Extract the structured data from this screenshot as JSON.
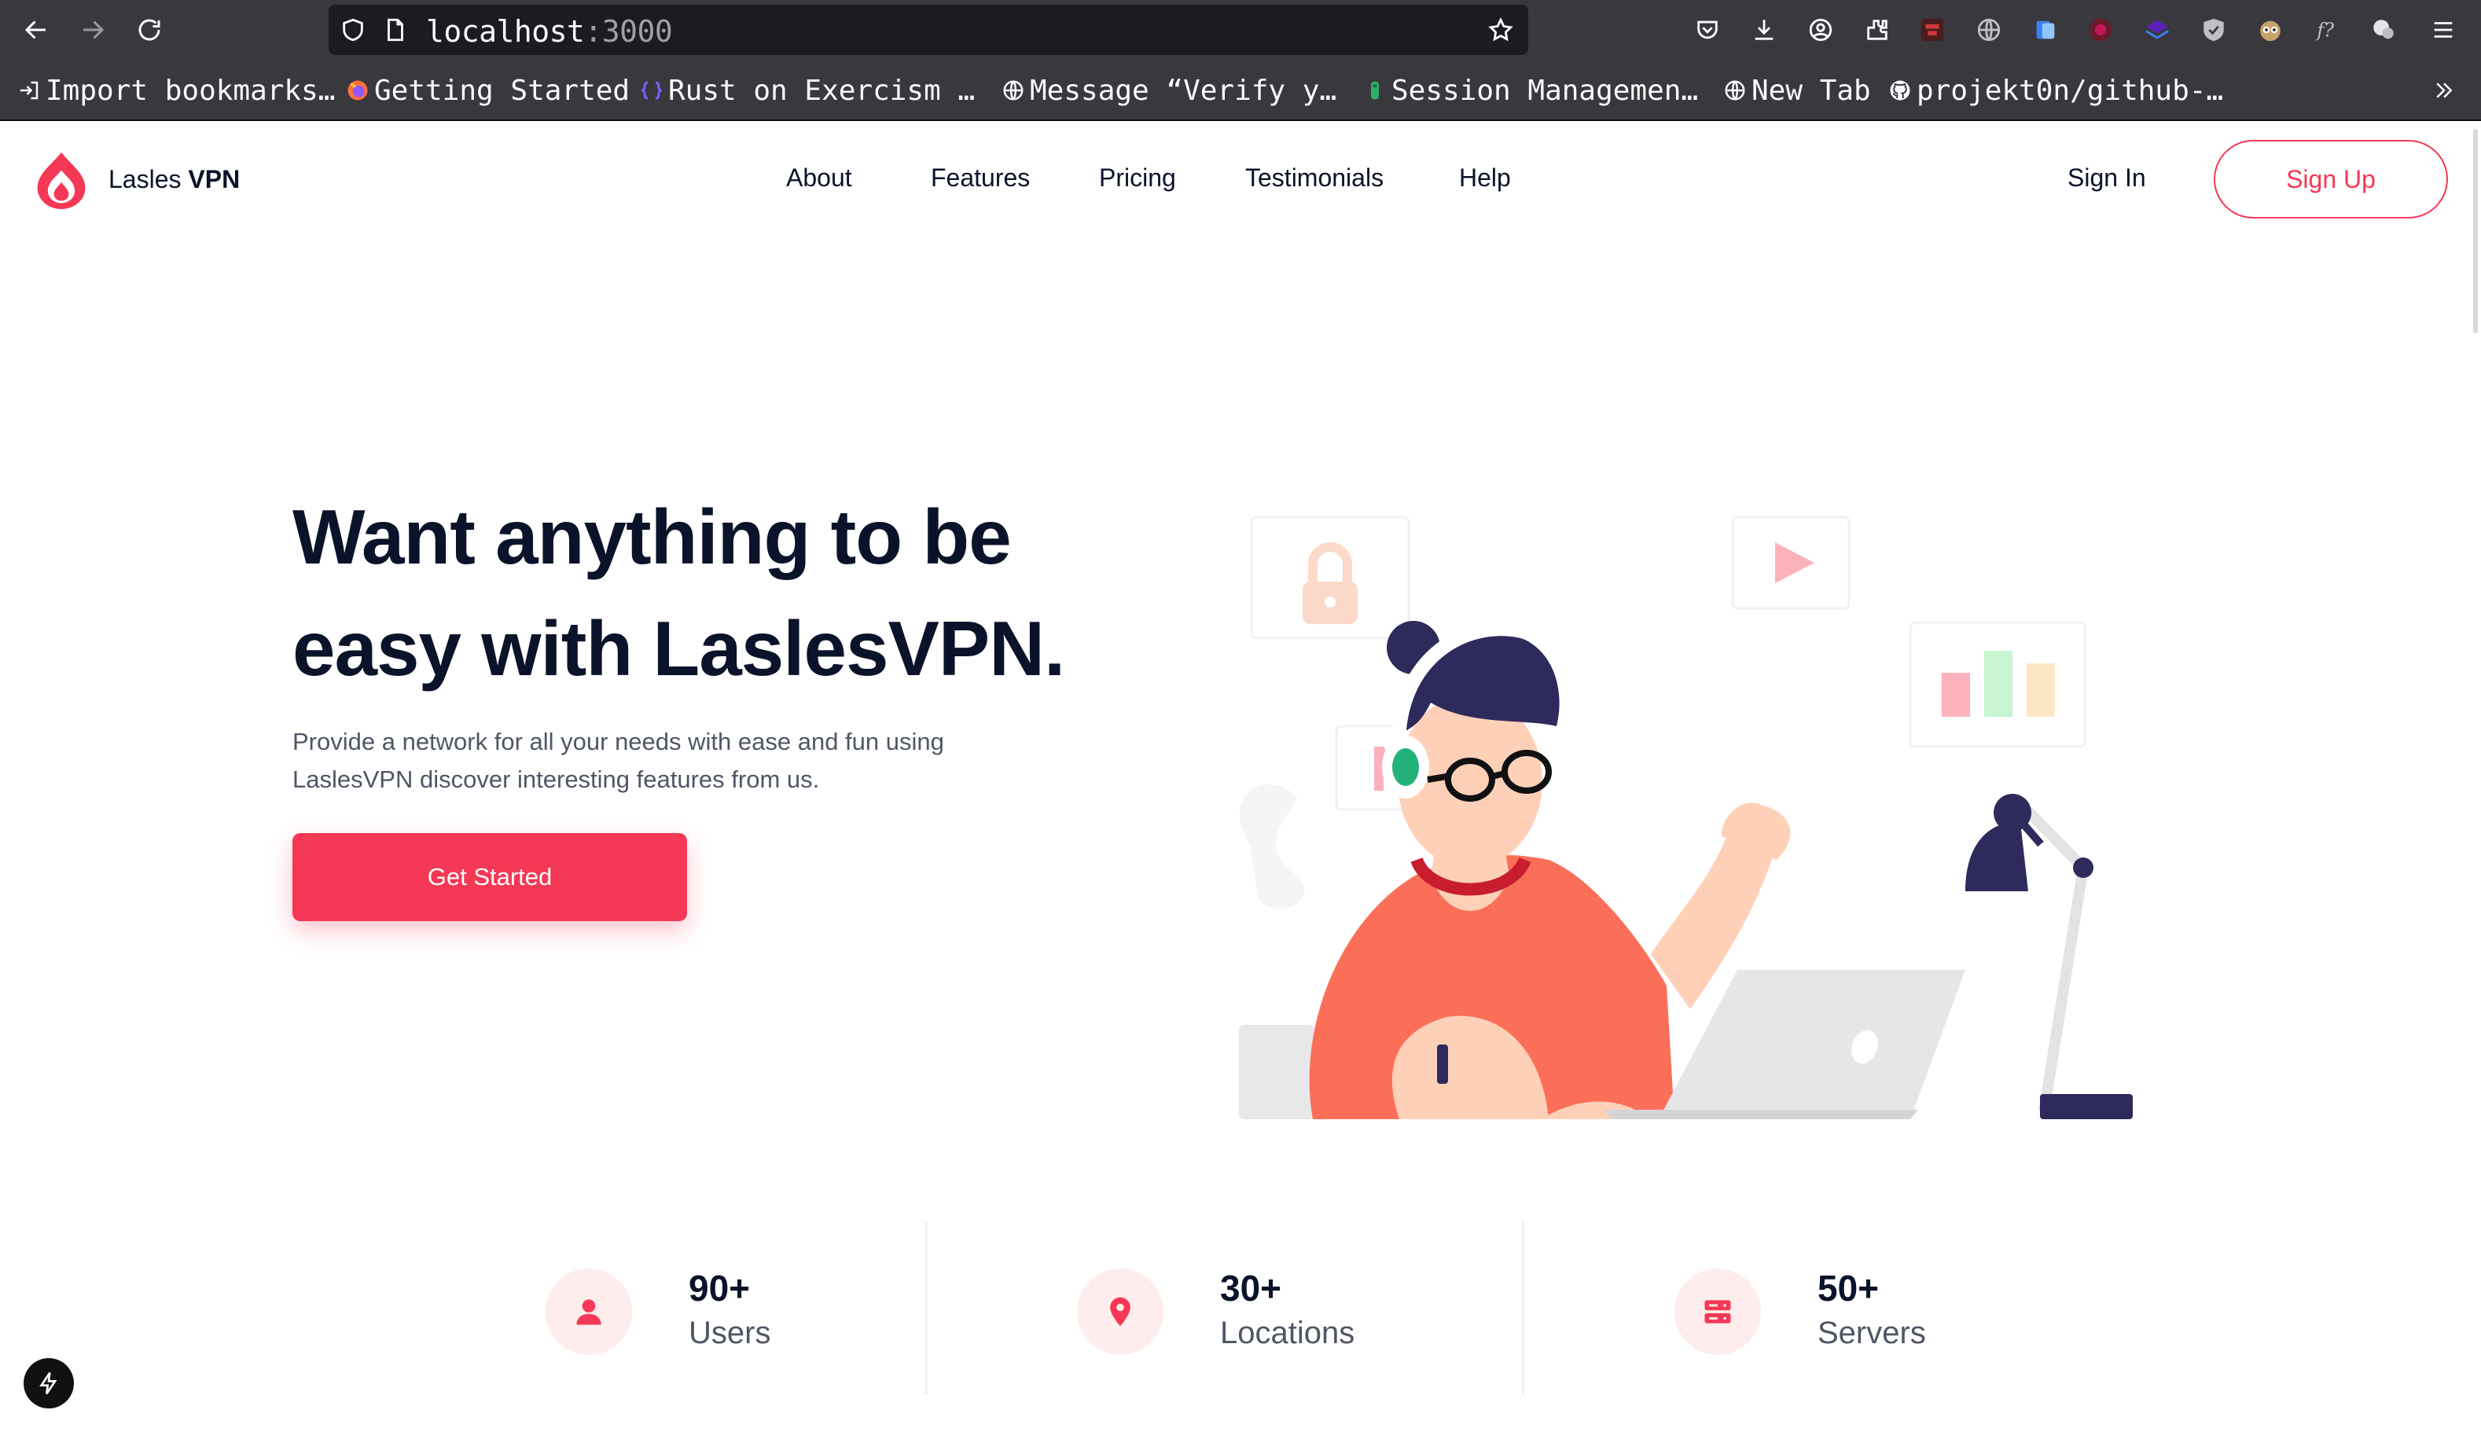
{
  "browser": {
    "url_host": "localhost",
    "url_port": ":3000",
    "bookmarks": [
      {
        "label": "Import bookmarks…",
        "icon": "import-icon"
      },
      {
        "label": "Getting Started",
        "icon": "firefox-icon"
      },
      {
        "label": "Rust on Exercism …",
        "icon": "exercism-icon"
      },
      {
        "label": "Message “Verify y…",
        "icon": "globe-icon"
      },
      {
        "label": "Session Managemen…",
        "icon": "session-icon"
      },
      {
        "label": "New Tab",
        "icon": "globe-icon"
      },
      {
        "label": "projekt0n/github-…",
        "icon": "github-icon"
      }
    ]
  },
  "nav": {
    "brand_light": "Lasles ",
    "brand_bold": "VPN",
    "links": [
      "About",
      "Features",
      "Pricing",
      "Testimonials",
      "Help"
    ],
    "sign_in": "Sign In",
    "sign_up": "Sign Up"
  },
  "hero": {
    "title_line1": "Want anything to be",
    "title_line2": "easy with LaslesVPN.",
    "subtitle_line1": "Provide a network for all your needs with ease and fun using",
    "subtitle_line2": "LaslesVPN discover interesting features from us.",
    "cta": "Get Started"
  },
  "stats": [
    {
      "value": "90+",
      "label": "Users",
      "icon": "user-icon"
    },
    {
      "value": "30+",
      "label": "Locations",
      "icon": "location-pin-icon"
    },
    {
      "value": "50+",
      "label": "Servers",
      "icon": "server-icon"
    }
  ],
  "colors": {
    "accent": "#F53855",
    "text_dark": "#0B132A",
    "text_muted": "#4F5665",
    "stat_icon_bg": "#FFECEC",
    "chrome_bg": "#38383D",
    "urlbar_bg": "#1C1B22"
  }
}
